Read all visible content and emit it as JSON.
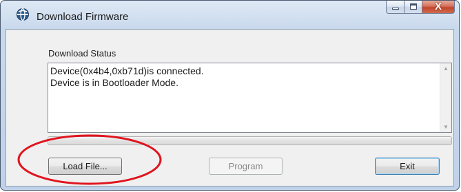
{
  "window": {
    "title": "Download Firmware",
    "icon": "app-globe-icon",
    "caption_buttons": {
      "minimize": "minimize-icon",
      "maximize": "maximize-icon",
      "close": "X"
    }
  },
  "status": {
    "group_label": "Download Status",
    "lines": [
      "Device(0x4b4,0xb71d)is connected.",
      "Device is in Bootloader Mode."
    ]
  },
  "progress": {
    "value": 0
  },
  "buttons": {
    "load_file": "Load File...",
    "program": "Program",
    "exit": "Exit"
  },
  "annotation": {
    "color": "#e0141e",
    "shape": "red-ellipse"
  }
}
